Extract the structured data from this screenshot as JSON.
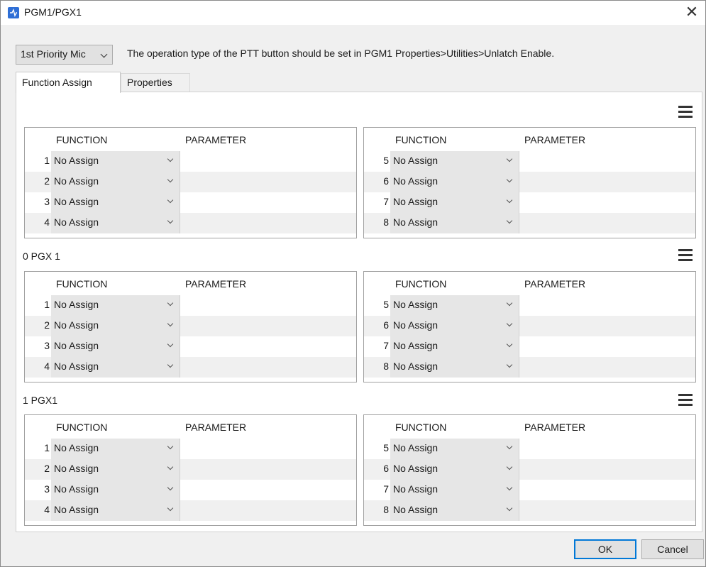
{
  "window": {
    "title": "PGM1/PGX1",
    "close_glyph": "✕",
    "app_icon": "app-icon"
  },
  "toolbar": {
    "mic_select": "1st Priority Mic",
    "info": "The operation type of the PTT button should be set in PGM1 Properties>Utilities>Unlatch Enable."
  },
  "tabs": [
    {
      "label": "Function Assign",
      "active": true
    },
    {
      "label": "Properties",
      "active": false
    }
  ],
  "columns": {
    "function": "FUNCTION",
    "parameter": "PARAMETER"
  },
  "groups": [
    {
      "label": "",
      "left": [
        {
          "num": "1",
          "value": "No Assign"
        },
        {
          "num": "2",
          "value": "No Assign"
        },
        {
          "num": "3",
          "value": "No Assign"
        },
        {
          "num": "4",
          "value": "No Assign"
        }
      ],
      "right": [
        {
          "num": "5",
          "value": "No Assign"
        },
        {
          "num": "6",
          "value": "No Assign"
        },
        {
          "num": "7",
          "value": "No Assign"
        },
        {
          "num": "8",
          "value": "No Assign"
        }
      ]
    },
    {
      "label": "0 PGX 1",
      "left": [
        {
          "num": "1",
          "value": "No Assign"
        },
        {
          "num": "2",
          "value": "No Assign"
        },
        {
          "num": "3",
          "value": "No Assign"
        },
        {
          "num": "4",
          "value": "No Assign"
        }
      ],
      "right": [
        {
          "num": "5",
          "value": "No Assign"
        },
        {
          "num": "6",
          "value": "No Assign"
        },
        {
          "num": "7",
          "value": "No Assign"
        },
        {
          "num": "8",
          "value": "No Assign"
        }
      ]
    },
    {
      "label": "1 PGX1",
      "left": [
        {
          "num": "1",
          "value": "No Assign"
        },
        {
          "num": "2",
          "value": "No Assign"
        },
        {
          "num": "3",
          "value": "No Assign"
        },
        {
          "num": "4",
          "value": "No Assign"
        }
      ],
      "right": [
        {
          "num": "5",
          "value": "No Assign"
        },
        {
          "num": "6",
          "value": "No Assign"
        },
        {
          "num": "7",
          "value": "No Assign"
        },
        {
          "num": "8",
          "value": "No Assign"
        }
      ]
    }
  ],
  "buttons": {
    "ok": "OK",
    "cancel": "Cancel"
  },
  "colors": {
    "accent": "#0078d7",
    "app_icon": "#2f6fd6",
    "row_shade": "#f0f0f0"
  }
}
